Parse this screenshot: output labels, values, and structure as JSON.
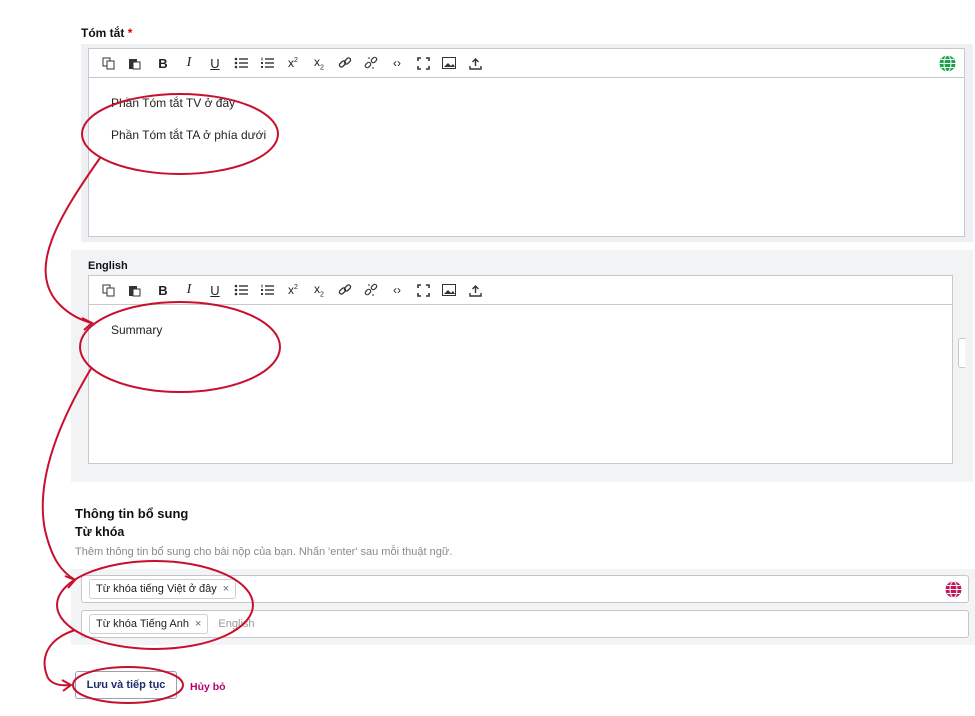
{
  "summary": {
    "label": "Tóm tắt",
    "required_mark": "*",
    "content": [
      "Phần Tóm tắt TV ở đây",
      "Phần Tóm tắt TA ở phía dưới"
    ]
  },
  "english": {
    "label": "English",
    "content": [
      "Summary"
    ]
  },
  "toolbar_icons": [
    "copy-icon",
    "paste-icon",
    "bold-icon",
    "italic-icon",
    "underline-icon",
    "bullet-list-icon",
    "numbered-list-icon",
    "superscript-icon",
    "subscript-icon",
    "link-icon",
    "unlink-icon",
    "code-icon",
    "fullscreen-icon",
    "image-icon",
    "upload-icon"
  ],
  "extra": {
    "section_title": "Thông tin bổ sung",
    "keywords_label": "Từ khóa",
    "keywords_help": "Thêm thông tin bổ sung cho bài nộp của bạn. Nhấn 'enter' sau mỗi thuật ngữ.",
    "keywords_vi": [
      "Từ khóa tiếng Việt ở đây"
    ],
    "keywords_en": [
      "Từ khóa Tiếng Anh"
    ],
    "english_placeholder": "English",
    "remove_symbol": "×"
  },
  "actions": {
    "save_label": "Lưu và tiếp tục",
    "cancel_label": "Hủy bỏ"
  },
  "colors": {
    "annotation_red": "#c8102e",
    "globe_green": "#1aa34a",
    "globe_pink": "#c2185b",
    "cancel_link": "#b5006a",
    "required": "#d00000"
  }
}
